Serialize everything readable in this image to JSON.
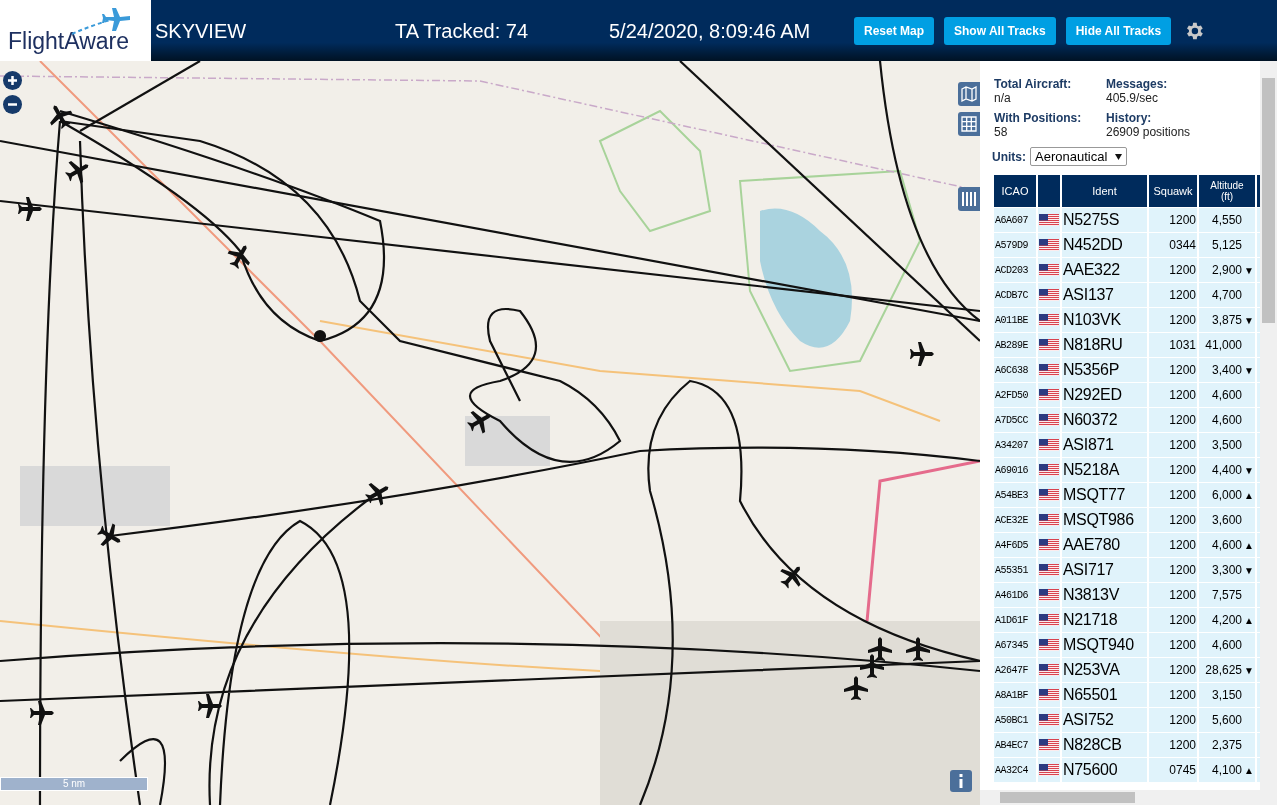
{
  "header": {
    "logo": "FlightAware",
    "title": "SKYVIEW",
    "tracked": "TA Tracked: 74",
    "datetime": "5/24/2020, 8:09:46 AM",
    "buttons": [
      "Reset Map",
      "Show All Tracks",
      "Hide All Tracks"
    ]
  },
  "map": {
    "scale": "5 nm"
  },
  "stats": [
    {
      "label": "Total Aircraft:",
      "value": "n/a"
    },
    {
      "label": "Messages:",
      "value": "405.9/sec"
    },
    {
      "label": "With Positions:",
      "value": "58"
    },
    {
      "label": "History:",
      "value": "26909 positions"
    }
  ],
  "units": {
    "label": "Units:",
    "value": "Aeronautical"
  },
  "table": {
    "columns": [
      "ICAO",
      "Ident",
      "Squawk",
      "Altitude (ft)"
    ],
    "rows": [
      {
        "icao": "A6A607",
        "ident": "N5275S",
        "squawk": "1200",
        "altitude": "4,550"
      },
      {
        "icao": "A579D9",
        "ident": "N452DD",
        "squawk": "0344",
        "altitude": "5,125"
      },
      {
        "icao": "ACD203",
        "ident": "AAE322",
        "squawk": "1200",
        "altitude": "2,900",
        "trend": "▼"
      },
      {
        "icao": "ACDB7C",
        "ident": "ASI137",
        "squawk": "1200",
        "altitude": "4,700"
      },
      {
        "icao": "A011BE",
        "ident": "N103VK",
        "squawk": "1200",
        "altitude": "3,875",
        "trend": "▼"
      },
      {
        "icao": "AB289E",
        "ident": "N818RU",
        "squawk": "1031",
        "altitude": "41,000"
      },
      {
        "icao": "A6C638",
        "ident": "N5356P",
        "squawk": "1200",
        "altitude": "3,400",
        "trend": "▼"
      },
      {
        "icao": "A2FD50",
        "ident": "N292ED",
        "squawk": "1200",
        "altitude": "4,600"
      },
      {
        "icao": "A7D5CC",
        "ident": "N60372",
        "squawk": "1200",
        "altitude": "4,600"
      },
      {
        "icao": "A34207",
        "ident": "ASI871",
        "squawk": "1200",
        "altitude": "3,500"
      },
      {
        "icao": "A69016",
        "ident": "N5218A",
        "squawk": "1200",
        "altitude": "4,400",
        "trend": "▼"
      },
      {
        "icao": "A54BE3",
        "ident": "MSQT77",
        "squawk": "1200",
        "altitude": "6,000",
        "trend": "▲"
      },
      {
        "icao": "ACE32E",
        "ident": "MSQT986",
        "squawk": "1200",
        "altitude": "3,600"
      },
      {
        "icao": "A4F6D5",
        "ident": "AAE780",
        "squawk": "1200",
        "altitude": "4,600",
        "trend": "▲"
      },
      {
        "icao": "A55351",
        "ident": "ASI717",
        "squawk": "1200",
        "altitude": "3,300",
        "trend": "▼"
      },
      {
        "icao": "A461D6",
        "ident": "N3813V",
        "squawk": "1200",
        "altitude": "7,575"
      },
      {
        "icao": "A1D61F",
        "ident": "N21718",
        "squawk": "1200",
        "altitude": "4,200",
        "trend": "▲"
      },
      {
        "icao": "A67345",
        "ident": "MSQT940",
        "squawk": "1200",
        "altitude": "4,600"
      },
      {
        "icao": "A2647F",
        "ident": "N253VA",
        "squawk": "1200",
        "altitude": "28,625",
        "trend": "▼"
      },
      {
        "icao": "A8A1BF",
        "ident": "N65501",
        "squawk": "1200",
        "altitude": "3,150"
      },
      {
        "icao": "A50BC1",
        "ident": "ASI752",
        "squawk": "1200",
        "altitude": "5,600"
      },
      {
        "icao": "AB4EC7",
        "ident": "N828CB",
        "squawk": "1200",
        "altitude": "2,375"
      },
      {
        "icao": "AA32C4",
        "ident": "N75600",
        "squawk": "0745",
        "altitude": "4,100",
        "trend": "▲"
      }
    ]
  }
}
